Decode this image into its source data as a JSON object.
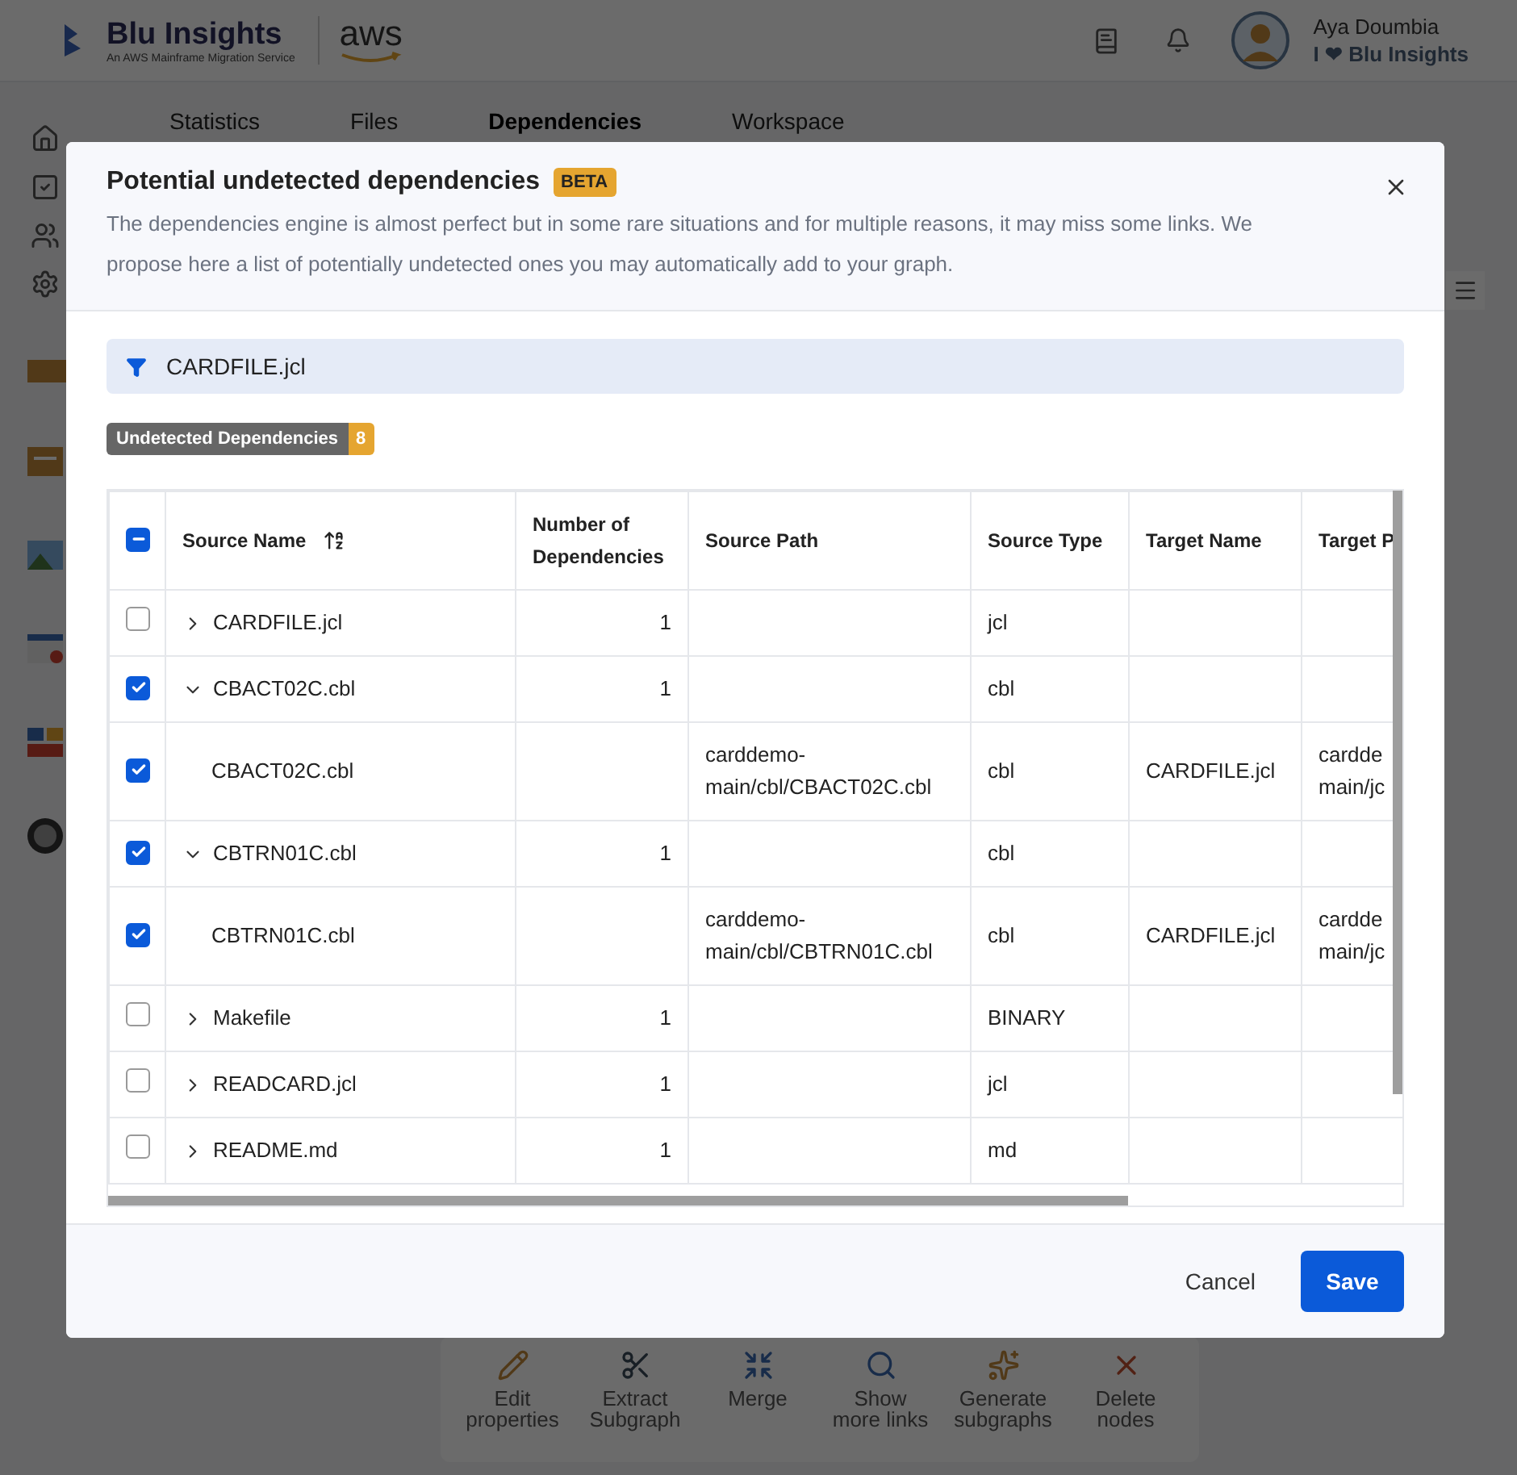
{
  "app_header": {
    "brand": "Blu Insights",
    "tagline": "An AWS Mainframe Migration Service",
    "partner": "aws",
    "user": {
      "name": "Aya Doumbia",
      "motto": "I ❤ Blu Insights"
    }
  },
  "page_tabs": [
    {
      "label": "Statistics",
      "selected": false
    },
    {
      "label": "Files",
      "selected": false
    },
    {
      "label": "Dependencies",
      "selected": true
    },
    {
      "label": "Workspace",
      "selected": false
    }
  ],
  "graph_toolbar": [
    {
      "label": "Edit properties",
      "kind": "edit"
    },
    {
      "label": "Extract Subgraph",
      "kind": "extract"
    },
    {
      "label": "Merge",
      "kind": "merge"
    },
    {
      "label": "Show more links",
      "kind": "links"
    },
    {
      "label": "Generate subgraphs",
      "kind": "generate"
    },
    {
      "label": "Delete nodes",
      "kind": "delete"
    }
  ],
  "dialog": {
    "title": "Potential undetected dependencies",
    "badge": "BETA",
    "description": "The dependencies engine is almost perfect but in some rare situations and for multiple reasons, it may miss some links. We propose here a list of potentially undetected ones you may automatically add to your graph.",
    "filter": "CARDFILE.jcl",
    "count_label": "Undetected Dependencies",
    "count": "8",
    "table": {
      "select_all_indeterminate": true,
      "columns": [
        "Source Name",
        "Number of Dependencies",
        "Source Path",
        "Source Type",
        "Target Name",
        "Target P"
      ],
      "rows": [
        {
          "name": "CARDFILE.jcl",
          "checked": false,
          "expanded": false,
          "dependencies": "1",
          "source_type": "jcl"
        },
        {
          "name": "CBACT02C.cbl",
          "checked": true,
          "expanded": true,
          "dependencies": "1",
          "source_type": "cbl",
          "children": [
            {
              "name": "CBACT02C.cbl",
              "checked": true,
              "source_path": "carddemo-main/cbl/CBACT02C.cbl",
              "source_type": "cbl",
              "target_name": "CARDFILE.jcl",
              "target_path": "cardde\nmain/jc"
            }
          ]
        },
        {
          "name": "CBTRN01C.cbl",
          "checked": true,
          "expanded": true,
          "dependencies": "1",
          "source_type": "cbl",
          "children": [
            {
              "name": "CBTRN01C.cbl",
              "checked": true,
              "source_path": "carddemo-main/cbl/CBTRN01C.cbl",
              "source_type": "cbl",
              "target_name": "CARDFILE.jcl",
              "target_path": "cardde\nmain/jc"
            }
          ]
        },
        {
          "name": "Makefile",
          "checked": false,
          "expanded": false,
          "dependencies": "1",
          "source_type": "BINARY"
        },
        {
          "name": "READCARD.jcl",
          "checked": false,
          "expanded": false,
          "dependencies": "1",
          "source_type": "jcl"
        },
        {
          "name": "README.md",
          "checked": false,
          "expanded": false,
          "dependencies": "1",
          "source_type": "md"
        }
      ]
    },
    "buttons": {
      "cancel": "Cancel",
      "save": "Save"
    }
  }
}
